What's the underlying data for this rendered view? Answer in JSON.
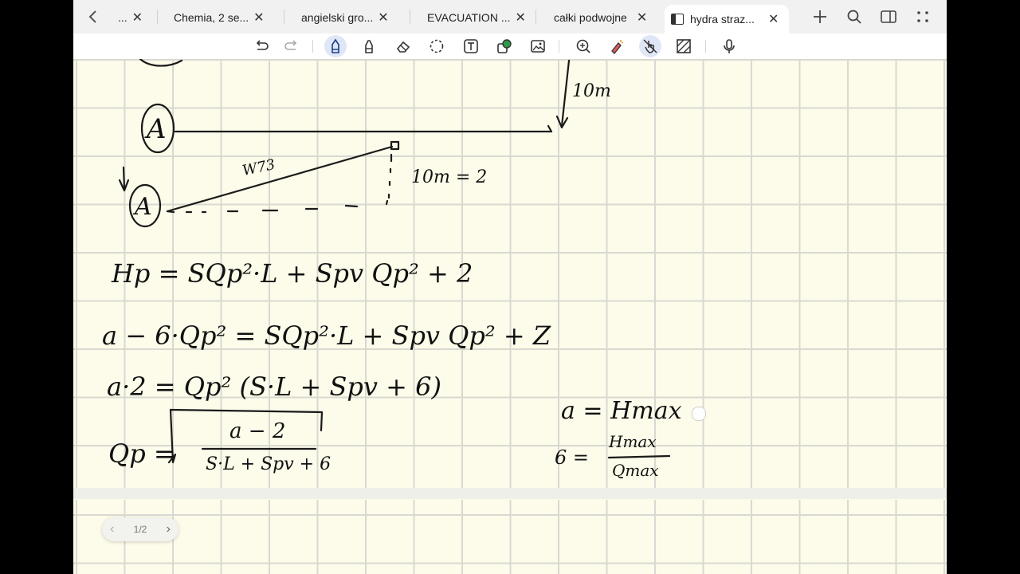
{
  "tabs": [
    {
      "label": "...",
      "close": "✕"
    },
    {
      "label": "Chemia, 2 se...",
      "close": "✕"
    },
    {
      "label": "angielski gro...",
      "close": "✕"
    },
    {
      "label": "EVACUATION ...",
      "close": "✕"
    },
    {
      "label": "całki podwojne",
      "close": "✕"
    },
    {
      "label": "hydra straz...",
      "close": "✕",
      "active": true
    }
  ],
  "tabbar_icons": [
    "back-chevron-icon",
    "new-tab-plus-icon",
    "search-icon",
    "split-view-icon",
    "more-dots-icon"
  ],
  "toolbar_icons": [
    "undo-icon",
    "redo-icon",
    "pen-icon",
    "highlighter-icon",
    "eraser-icon",
    "lasso-icon",
    "text-box-icon",
    "shapes-icon",
    "image-icon",
    "zoom-icon",
    "laser-pointer-icon",
    "touch-write-icon",
    "pattern-icon",
    "microphone-icon"
  ],
  "handwriting": {
    "label_a_top": "A",
    "label_a_bottom": "A",
    "top_height": "10m",
    "hose": "W73",
    "bottom_height": "10m = 2",
    "eq1": "Hp = SQp²·L + Spv Qp² + 2",
    "eq2": "a − 6·Qp² = SQp²·L + Spv Qp² + Z",
    "eq3": "a·2 = Qp² (S·L + Spv + 6)",
    "eq4_lhs": "Qp =",
    "eq4_num": "a − 2",
    "eq4_den": "S·L + Spv + 6",
    "note_a": "a = Hmax",
    "note_b_lhs": "6 =",
    "note_b_num": "Hmax",
    "note_b_den": "Qmax"
  },
  "pager": {
    "text": "1/2",
    "prev": "‹",
    "next": "›"
  },
  "colors": {
    "paper": "#fdfbe9",
    "grid": "#d9d9d2",
    "ink": "#1a1a1a",
    "tabbar": "#f1f1f1",
    "selected_tool": "#dfe7f7"
  }
}
